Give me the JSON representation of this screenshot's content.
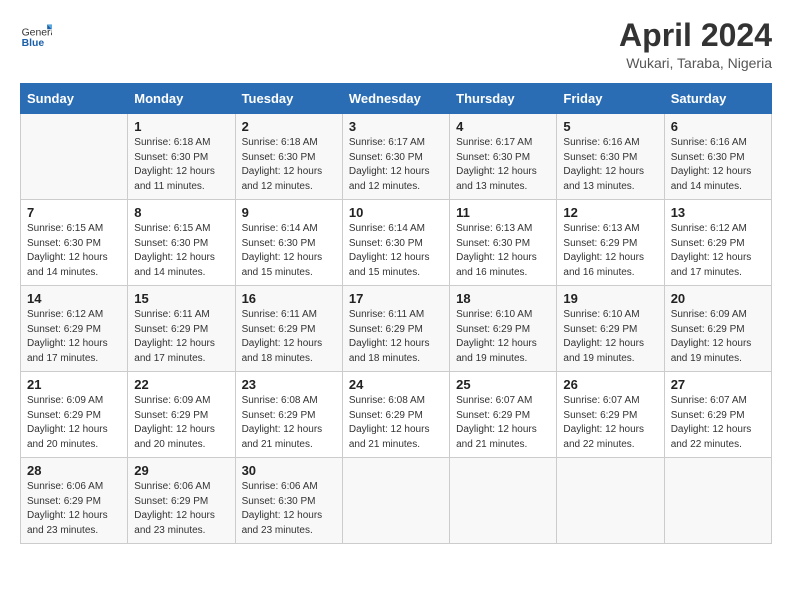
{
  "logo": {
    "general": "General",
    "blue": "Blue"
  },
  "title": "April 2024",
  "subtitle": "Wukari, Taraba, Nigeria",
  "days_of_week": [
    "Sunday",
    "Monday",
    "Tuesday",
    "Wednesday",
    "Thursday",
    "Friday",
    "Saturday"
  ],
  "weeks": [
    [
      {
        "num": "",
        "info": ""
      },
      {
        "num": "1",
        "info": "Sunrise: 6:18 AM\nSunset: 6:30 PM\nDaylight: 12 hours\nand 11 minutes."
      },
      {
        "num": "2",
        "info": "Sunrise: 6:18 AM\nSunset: 6:30 PM\nDaylight: 12 hours\nand 12 minutes."
      },
      {
        "num": "3",
        "info": "Sunrise: 6:17 AM\nSunset: 6:30 PM\nDaylight: 12 hours\nand 12 minutes."
      },
      {
        "num": "4",
        "info": "Sunrise: 6:17 AM\nSunset: 6:30 PM\nDaylight: 12 hours\nand 13 minutes."
      },
      {
        "num": "5",
        "info": "Sunrise: 6:16 AM\nSunset: 6:30 PM\nDaylight: 12 hours\nand 13 minutes."
      },
      {
        "num": "6",
        "info": "Sunrise: 6:16 AM\nSunset: 6:30 PM\nDaylight: 12 hours\nand 14 minutes."
      }
    ],
    [
      {
        "num": "7",
        "info": "Sunrise: 6:15 AM\nSunset: 6:30 PM\nDaylight: 12 hours\nand 14 minutes."
      },
      {
        "num": "8",
        "info": "Sunrise: 6:15 AM\nSunset: 6:30 PM\nDaylight: 12 hours\nand 14 minutes."
      },
      {
        "num": "9",
        "info": "Sunrise: 6:14 AM\nSunset: 6:30 PM\nDaylight: 12 hours\nand 15 minutes."
      },
      {
        "num": "10",
        "info": "Sunrise: 6:14 AM\nSunset: 6:30 PM\nDaylight: 12 hours\nand 15 minutes."
      },
      {
        "num": "11",
        "info": "Sunrise: 6:13 AM\nSunset: 6:30 PM\nDaylight: 12 hours\nand 16 minutes."
      },
      {
        "num": "12",
        "info": "Sunrise: 6:13 AM\nSunset: 6:29 PM\nDaylight: 12 hours\nand 16 minutes."
      },
      {
        "num": "13",
        "info": "Sunrise: 6:12 AM\nSunset: 6:29 PM\nDaylight: 12 hours\nand 17 minutes."
      }
    ],
    [
      {
        "num": "14",
        "info": "Sunrise: 6:12 AM\nSunset: 6:29 PM\nDaylight: 12 hours\nand 17 minutes."
      },
      {
        "num": "15",
        "info": "Sunrise: 6:11 AM\nSunset: 6:29 PM\nDaylight: 12 hours\nand 17 minutes."
      },
      {
        "num": "16",
        "info": "Sunrise: 6:11 AM\nSunset: 6:29 PM\nDaylight: 12 hours\nand 18 minutes."
      },
      {
        "num": "17",
        "info": "Sunrise: 6:11 AM\nSunset: 6:29 PM\nDaylight: 12 hours\nand 18 minutes."
      },
      {
        "num": "18",
        "info": "Sunrise: 6:10 AM\nSunset: 6:29 PM\nDaylight: 12 hours\nand 19 minutes."
      },
      {
        "num": "19",
        "info": "Sunrise: 6:10 AM\nSunset: 6:29 PM\nDaylight: 12 hours\nand 19 minutes."
      },
      {
        "num": "20",
        "info": "Sunrise: 6:09 AM\nSunset: 6:29 PM\nDaylight: 12 hours\nand 19 minutes."
      }
    ],
    [
      {
        "num": "21",
        "info": "Sunrise: 6:09 AM\nSunset: 6:29 PM\nDaylight: 12 hours\nand 20 minutes."
      },
      {
        "num": "22",
        "info": "Sunrise: 6:09 AM\nSunset: 6:29 PM\nDaylight: 12 hours\nand 20 minutes."
      },
      {
        "num": "23",
        "info": "Sunrise: 6:08 AM\nSunset: 6:29 PM\nDaylight: 12 hours\nand 21 minutes."
      },
      {
        "num": "24",
        "info": "Sunrise: 6:08 AM\nSunset: 6:29 PM\nDaylight: 12 hours\nand 21 minutes."
      },
      {
        "num": "25",
        "info": "Sunrise: 6:07 AM\nSunset: 6:29 PM\nDaylight: 12 hours\nand 21 minutes."
      },
      {
        "num": "26",
        "info": "Sunrise: 6:07 AM\nSunset: 6:29 PM\nDaylight: 12 hours\nand 22 minutes."
      },
      {
        "num": "27",
        "info": "Sunrise: 6:07 AM\nSunset: 6:29 PM\nDaylight: 12 hours\nand 22 minutes."
      }
    ],
    [
      {
        "num": "28",
        "info": "Sunrise: 6:06 AM\nSunset: 6:29 PM\nDaylight: 12 hours\nand 23 minutes."
      },
      {
        "num": "29",
        "info": "Sunrise: 6:06 AM\nSunset: 6:29 PM\nDaylight: 12 hours\nand 23 minutes."
      },
      {
        "num": "30",
        "info": "Sunrise: 6:06 AM\nSunset: 6:30 PM\nDaylight: 12 hours\nand 23 minutes."
      },
      {
        "num": "",
        "info": ""
      },
      {
        "num": "",
        "info": ""
      },
      {
        "num": "",
        "info": ""
      },
      {
        "num": "",
        "info": ""
      }
    ]
  ]
}
